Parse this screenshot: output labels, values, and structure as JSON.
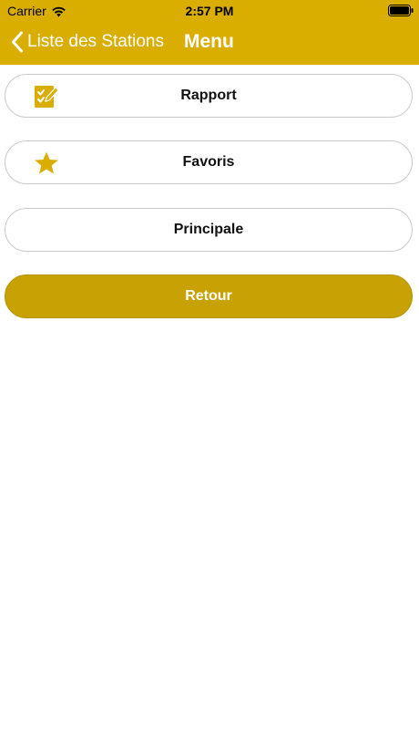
{
  "status_bar": {
    "carrier": "Carrier",
    "time": "2:57 PM",
    "wifi_icon": "wifi-icon",
    "battery_icon": "battery-icon"
  },
  "nav": {
    "back_label": "Liste des Stations",
    "title": "Menu",
    "background_color": "#d9ae00"
  },
  "menu": {
    "items": [
      {
        "label": "Rapport",
        "icon": "checklist-icon"
      },
      {
        "label": "Favoris",
        "icon": "star-icon"
      },
      {
        "label": "Principale",
        "icon": ""
      }
    ],
    "return_label": "Retour",
    "return_color": "#c8a205",
    "icon_color": "#d9ae00"
  }
}
